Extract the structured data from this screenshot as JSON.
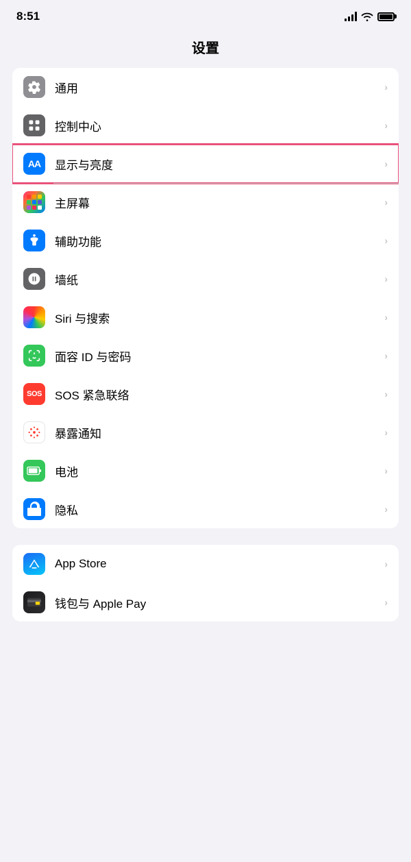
{
  "statusBar": {
    "time": "8:51"
  },
  "pageTitle": "设置",
  "groups": [
    {
      "id": "group1",
      "items": [
        {
          "id": "general",
          "label": "通用",
          "iconType": "gear",
          "iconBg": "gray",
          "highlighted": false
        },
        {
          "id": "control-center",
          "label": "控制中心",
          "iconType": "toggle",
          "iconBg": "dark-gray",
          "highlighted": false
        },
        {
          "id": "display",
          "label": "显示与亮度",
          "iconType": "aa",
          "iconBg": "blue",
          "highlighted": true
        },
        {
          "id": "homescreen",
          "label": "主屏幕",
          "iconType": "grid",
          "iconBg": "colorful",
          "highlighted": false
        },
        {
          "id": "accessibility",
          "label": "辅助功能",
          "iconType": "accessibility",
          "iconBg": "light-blue",
          "highlighted": false
        },
        {
          "id": "wallpaper",
          "label": "墙纸",
          "iconType": "flower",
          "iconBg": "dark-gray",
          "highlighted": false
        },
        {
          "id": "siri",
          "label": "Siri 与搜索",
          "iconType": "siri",
          "iconBg": "siri",
          "highlighted": false
        },
        {
          "id": "faceid",
          "label": "面容 ID 与密码",
          "iconType": "faceid",
          "iconBg": "green",
          "highlighted": false
        },
        {
          "id": "sos",
          "label": "SOS 紧急联络",
          "iconType": "sos",
          "iconBg": "red",
          "highlighted": false
        },
        {
          "id": "exposure",
          "label": "暴露通知",
          "iconType": "exposure",
          "iconBg": "white",
          "highlighted": false
        },
        {
          "id": "battery",
          "label": "电池",
          "iconType": "battery",
          "iconBg": "battery-green",
          "highlighted": false
        },
        {
          "id": "privacy",
          "label": "隐私",
          "iconType": "hand",
          "iconBg": "blue-hand",
          "highlighted": false
        }
      ]
    },
    {
      "id": "group2",
      "items": [
        {
          "id": "appstore",
          "label": "App Store",
          "iconType": "appstore",
          "iconBg": "appstore",
          "highlighted": false
        },
        {
          "id": "wallet",
          "label": "钱包与 Apple Pay",
          "iconType": "wallet",
          "iconBg": "wallet",
          "highlighted": false
        }
      ]
    }
  ]
}
